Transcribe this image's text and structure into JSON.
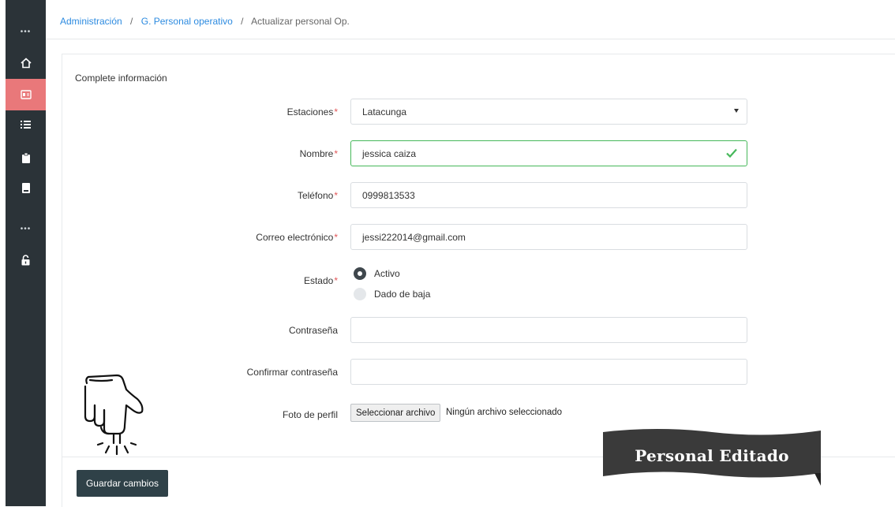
{
  "sidebar": {
    "items": [
      {
        "icon": "more-dots-icon"
      },
      {
        "icon": "home-icon"
      },
      {
        "icon": "id-card-icon",
        "active": true
      },
      {
        "icon": "list-icon"
      },
      {
        "icon": "clipboard-icon"
      },
      {
        "icon": "book-icon"
      },
      {
        "icon": "more-dots-icon"
      },
      {
        "icon": "unlock-icon"
      }
    ],
    "active_color": "#e9787a",
    "background": "#2b3338"
  },
  "breadcrumb": {
    "items": [
      "Administración",
      "G. Personal operativo",
      "Actualizar personal Op."
    ],
    "separator": "/"
  },
  "form": {
    "title": "Complete información",
    "stations": {
      "label": "Estaciones",
      "required": "*",
      "value": "Latacunga"
    },
    "name": {
      "label": "Nombre",
      "required": "*",
      "value": "jessica caiza"
    },
    "phone": {
      "label": "Teléfono",
      "required": "*",
      "value": "0999813533"
    },
    "email": {
      "label": "Correo electrónico",
      "required": "*",
      "value": "jessi222014@gmail.com"
    },
    "status": {
      "label": "Estado",
      "required": "*",
      "options": [
        "Activo",
        "Dado de baja"
      ],
      "selected": "Activo"
    },
    "password": {
      "label": "Contraseña",
      "value": ""
    },
    "confirm_password": {
      "label": "Confirmar contraseña",
      "value": ""
    },
    "photo": {
      "label": "Foto de perfil",
      "button": "Seleccionar archivo",
      "file_text": "Ningún archivo seleccionado"
    },
    "save_button": "Guardar cambios"
  },
  "banner": {
    "text": "Personal Editado"
  },
  "colors": {
    "link": "#2d8be0",
    "valid": "#46b85a",
    "required": "#e25759",
    "save_button": "#2f4148"
  }
}
